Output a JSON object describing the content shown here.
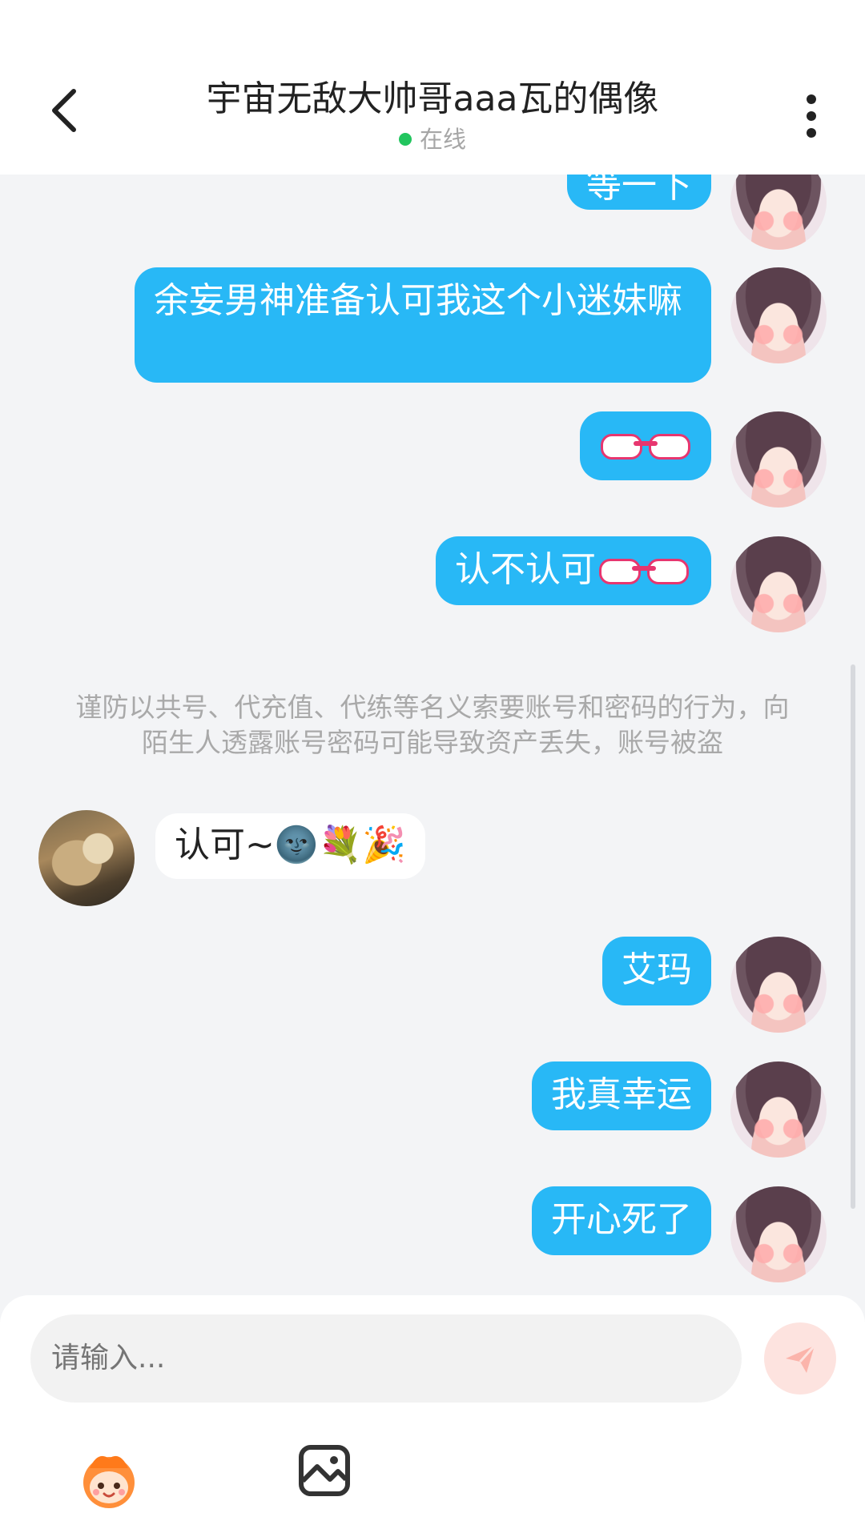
{
  "header": {
    "title": "宇宙无敌大帅哥aaa瓦的偶像",
    "status": "在线"
  },
  "messages": [
    {
      "side": "right",
      "text": "等一下"
    },
    {
      "side": "right",
      "text": "余妄男神准备认可我这个小迷妹嘛"
    },
    {
      "side": "right",
      "text": "👉👈"
    },
    {
      "side": "right",
      "text": "认不认可"
    },
    {
      "side": "left",
      "text": "认可~🌚💐🎉"
    },
    {
      "side": "right",
      "text": "艾玛"
    },
    {
      "side": "right",
      "text": "我真幸运"
    },
    {
      "side": "right",
      "text": "开心死了"
    }
  ],
  "notice": {
    "text": "谨防以共号、代充值、代练等名义索要账号和密码的行为，向陌生人透露账号密码可能导致资产丢失，账号被盗"
  },
  "composer": {
    "placeholder": "请输入..."
  },
  "colors": {
    "accent": "#28b8f6",
    "online": "#22c55e",
    "send_button": "#fde3df"
  }
}
